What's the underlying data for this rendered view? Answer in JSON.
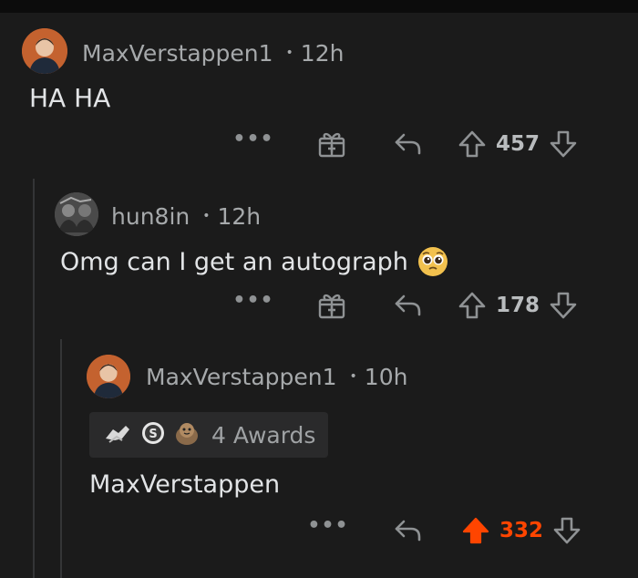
{
  "comments": [
    {
      "username": "MaxVerstappen1",
      "time": "12h",
      "body": "HA HA",
      "more_label": "•••",
      "votes": "457"
    },
    {
      "username": "hun8in",
      "time": "12h",
      "body": "Omg can I get an autograph",
      "emoji": "pleading-face",
      "more_label": "•••",
      "votes": "178"
    },
    {
      "username": "MaxVerstappen1",
      "time": "10h",
      "awards_label": "4 Awards",
      "body": "MaxVerstappen",
      "more_label": "•••",
      "votes": "332",
      "upvoted": true
    }
  ],
  "separator": "•",
  "colors": {
    "background": "#1b1b1b",
    "upvote_active": "#ff4500",
    "muted": "#8f9294",
    "text": "#e2e4e6"
  },
  "icons": [
    "avatar",
    "gift-icon",
    "reply-icon",
    "upvote-icon",
    "downvote-icon",
    "more-icon",
    "award-icon"
  ]
}
